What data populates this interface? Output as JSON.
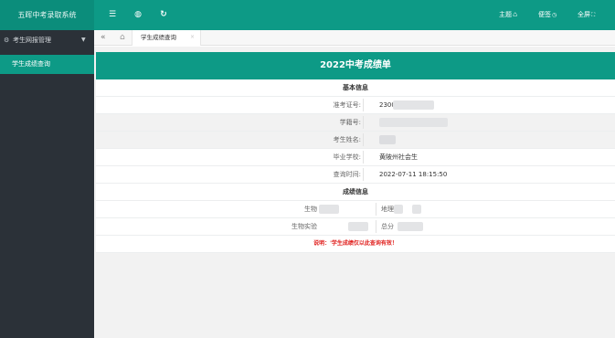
{
  "app": {
    "title": "五晖中考录取系统"
  },
  "topbar": {
    "menu_glyph": "☰",
    "globe_glyph": "◍",
    "refresh_glyph": "↻",
    "theme_label": "主题",
    "theme_glyph": "♺",
    "lock_label": "便签",
    "lock_glyph": "◷",
    "fullscreen_label": "全屏",
    "fullscreen_glyph": "⛶"
  },
  "sidebar": {
    "group_icon": "⚙",
    "group_label": "考生网报管理",
    "group_caret": "▼",
    "items": [
      {
        "label": "学生成绩查询"
      }
    ]
  },
  "tabbar": {
    "back_glyph": "«",
    "home_glyph": "⌂",
    "tabs": [
      {
        "label": "学生成绩查询",
        "close_glyph": "×"
      }
    ]
  },
  "report": {
    "title": "2022中考成绩单",
    "basic_section": "基本信息",
    "fields": [
      {
        "label": "准考证号:",
        "value": "2300"
      },
      {
        "label": "学籍号:",
        "value": ""
      },
      {
        "label": "考生姓名:",
        "value": ""
      },
      {
        "label": "毕业学校:",
        "value": "黄陂州社会生"
      },
      {
        "label": "查询时间:",
        "value": "2022-07-11 18:15:50"
      }
    ],
    "score_section": "成绩信息",
    "scores": [
      {
        "left_label": "生物",
        "right_label": "地理"
      },
      {
        "left_label": "生物实验",
        "right_label": "总分"
      }
    ],
    "note": "说明：'学生成绩仅以此查询有效！"
  },
  "colors": {
    "brand": "#0d9a86",
    "sidebar": "#2b3138",
    "note": "#e0201e"
  },
  "icons": [
    "menu-icon",
    "globe-icon",
    "refresh-icon",
    "theme-icon",
    "lock-icon",
    "fullscreen-icon",
    "gear-icon",
    "chevron-down-icon",
    "back-icon",
    "home-icon",
    "close-icon"
  ]
}
